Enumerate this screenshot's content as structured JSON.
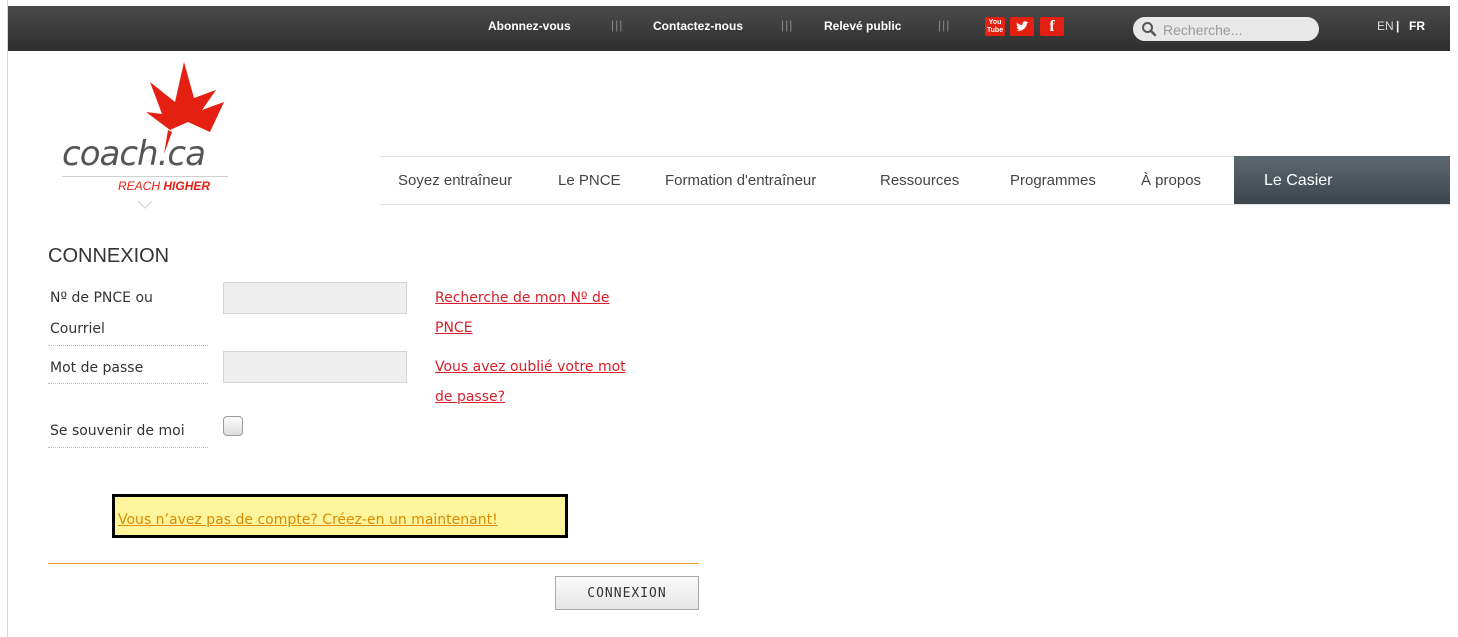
{
  "topbar": {
    "links": [
      "Abonnez-vous",
      "Contactez-nous",
      "Relevé public"
    ],
    "separator": "|||",
    "social": [
      {
        "icon": "youtube-icon",
        "label": "You Tube"
      },
      {
        "icon": "twitter-icon",
        "label": "✔"
      },
      {
        "icon": "facebook-icon",
        "label": "f"
      }
    ],
    "search_placeholder": "Recherche...",
    "lang_en": "EN",
    "lang_divider": "|",
    "lang_fr": "FR"
  },
  "logo": {
    "text": "coach.ca",
    "tagline_light": "REACH",
    "tagline_bold": "HIGHER"
  },
  "nav": {
    "items": [
      "Soyez entraîneur",
      "Le PNCE",
      "Formation d'entraîneur",
      "Ressources",
      "Programmes",
      "À propos"
    ],
    "highlight": "Le Casier"
  },
  "login": {
    "title": "CONNEXION",
    "id_label_line1": "Nº de PNCE ou",
    "id_label_line2": "Courriel",
    "password_label": "Mot de passe",
    "remember_label": "Se souvenir de moi",
    "find_id_line1": "Recherche de mon Nº de",
    "find_id_line2": "PNCE",
    "forgot_line1": "Vous avez oublié votre mot",
    "forgot_line2": "de passe?",
    "create_account": "Vous n’avez pas de compte? Créez-en un maintenant!",
    "submit": "CONNEXION"
  },
  "colors": {
    "accent_red": "#e32012",
    "link_red": "#d81f2a",
    "highlight_yellow": "#fff59d",
    "gold": "#d9a521"
  }
}
